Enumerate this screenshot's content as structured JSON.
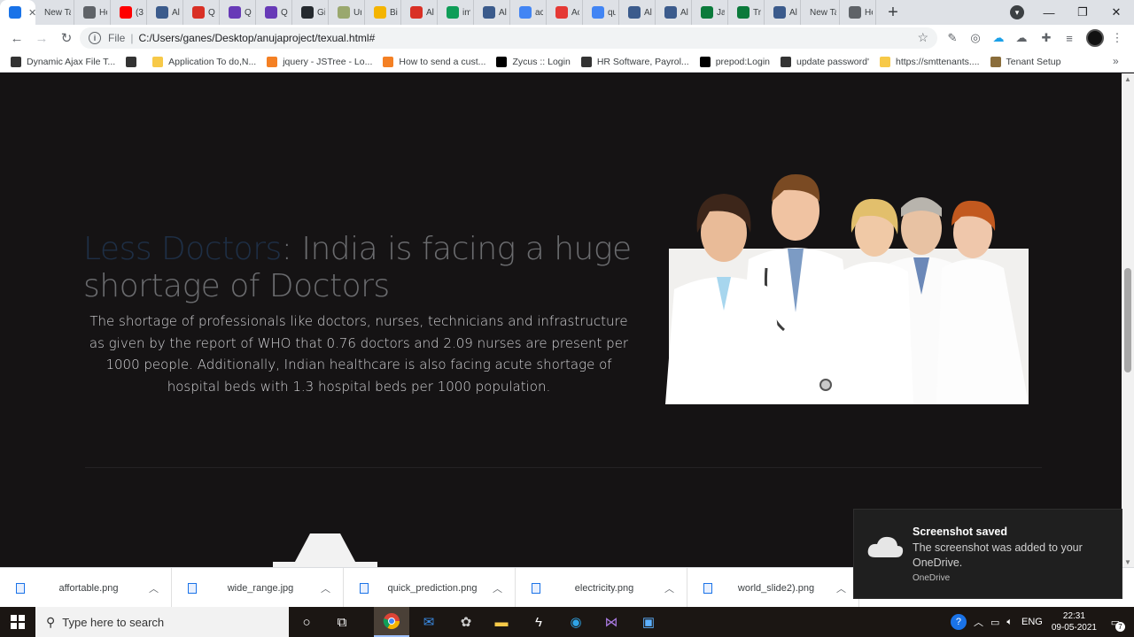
{
  "browser": {
    "tabs": [
      {
        "label": "",
        "icon": "app-icon",
        "color": "#1a73e8",
        "active": true
      },
      {
        "label": "New Tab",
        "icon": "none",
        "color": "#dee1e6"
      },
      {
        "label": "He",
        "icon": "globe-icon",
        "color": "#5f6368"
      },
      {
        "label": "(3",
        "icon": "youtube-icon",
        "color": "#ff0000"
      },
      {
        "label": "Al",
        "icon": "app-icon",
        "color": "#3b5b8c"
      },
      {
        "label": "Q",
        "icon": "gmail-icon",
        "color": "#d93025"
      },
      {
        "label": "Q",
        "icon": "forms-icon",
        "color": "#673ab7"
      },
      {
        "label": "Q",
        "icon": "forms-icon",
        "color": "#673ab7"
      },
      {
        "label": "Gi",
        "icon": "github-icon",
        "color": "#24292e"
      },
      {
        "label": "Ur",
        "icon": "b-icon",
        "color": "#9aa86e"
      },
      {
        "label": "Bi",
        "icon": "drive-icon",
        "color": "#f4b400"
      },
      {
        "label": "Al",
        "icon": "gmail-icon",
        "color": "#d93025"
      },
      {
        "label": "im",
        "icon": "drive-icon",
        "color": "#0f9d58"
      },
      {
        "label": "Al",
        "icon": "app-icon",
        "color": "#3b5b8c"
      },
      {
        "label": "ac",
        "icon": "google-icon",
        "color": "#4285f4"
      },
      {
        "label": "Ac",
        "icon": "red-app-icon",
        "color": "#e53935"
      },
      {
        "label": "qu",
        "icon": "google-icon",
        "color": "#4285f4"
      },
      {
        "label": "Al",
        "icon": "app-icon",
        "color": "#3b5b8c"
      },
      {
        "label": "Al",
        "icon": "app-icon",
        "color": "#3b5b8c"
      },
      {
        "label": "Ja",
        "icon": "w-icon",
        "color": "#0b7a3b"
      },
      {
        "label": "Tr",
        "icon": "w-icon",
        "color": "#0b7a3b"
      },
      {
        "label": "Al",
        "icon": "app-icon",
        "color": "#3b5b8c"
      },
      {
        "label": "New Tab",
        "icon": "none",
        "color": "#dee1e6"
      },
      {
        "label": "He",
        "icon": "diamond-icon",
        "color": "#5f6368"
      }
    ],
    "new_tab_glyph": "+",
    "address": {
      "scheme": "File",
      "url": "C:/Users/ganes/Desktop/anujaproject/texual.html#"
    },
    "bookmarks": [
      {
        "label": "Dynamic Ajax File T...",
        "icon": "loader-icon",
        "color": "#333333"
      },
      {
        "label": "",
        "icon": "globe-icon",
        "color": "#333333"
      },
      {
        "label": "Application To do,N...",
        "icon": "folder-icon",
        "color": "#f7c948"
      },
      {
        "label": "jquery - JSTree - Lo...",
        "icon": "stackoverflow-icon",
        "color": "#f48024"
      },
      {
        "label": "How to send a cust...",
        "icon": "stackoverflow-icon",
        "color": "#f48024"
      },
      {
        "label": "Zycus :: Login",
        "icon": "z-icon",
        "color": "#000000"
      },
      {
        "label": "HR Software, Payrol...",
        "icon": "globe-icon",
        "color": "#333333"
      },
      {
        "label": "prepod:Login",
        "icon": "z-icon",
        "color": "#000000"
      },
      {
        "label": "update password'",
        "icon": "globe-icon",
        "color": "#333333"
      },
      {
        "label": "https://smttenants....",
        "icon": "zolo-icon",
        "color": "#f7c948"
      },
      {
        "label": "Tenant Setup",
        "icon": "image-icon",
        "color": "#8a6d3b"
      }
    ],
    "bookmarks_more": "»"
  },
  "page": {
    "headline_accent": "Less Doctors",
    "headline_rest": ": India is facing a huge shortage of Doctors",
    "body": "The shortage of professionals like doctors, nurses, technicians and infrastructure as given by the report of WHO that 0.76 doctors and 2.09 nurses are present per 1000 people. Additionally, Indian healthcare is also facing acute shortage of hospital beds with 1.3 hospital beds per 1000 population."
  },
  "downloads": [
    {
      "name": "affortable.png"
    },
    {
      "name": "wide_range.jpg"
    },
    {
      "name": "quick_prediction.png"
    },
    {
      "name": "electricity.png"
    },
    {
      "name": "world_slide2).png"
    }
  ],
  "toast": {
    "title": "Screenshot saved",
    "body": "The screenshot was added to your OneDrive.",
    "app": "OneDrive"
  },
  "taskbar": {
    "search_placeholder": "Type here to search",
    "language": "ENG",
    "time": "22:31",
    "date": "09-05-2021",
    "notification_count": "7"
  }
}
